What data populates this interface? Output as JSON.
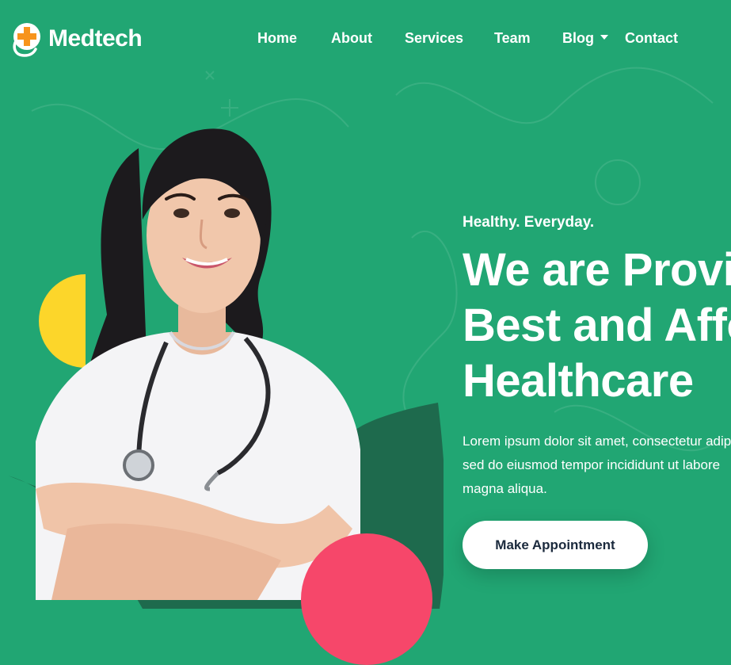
{
  "brand": {
    "name": "Medtech",
    "icon": "medical-cross-icon"
  },
  "nav": {
    "items": [
      {
        "label": "Home"
      },
      {
        "label": "About"
      },
      {
        "label": "Services"
      },
      {
        "label": "Team"
      },
      {
        "label": "Blog",
        "has_dropdown": true
      },
      {
        "label": "Contact"
      }
    ]
  },
  "hero": {
    "tagline": "Healthy. Everyday.",
    "headline_lines": [
      "We are Provi",
      "Best and Affo",
      "Healthcare"
    ],
    "description_lines": [
      "Lorem ipsum dolor sit amet, consectetur adip",
      "sed do eiusmod tempor incididunt ut labore",
      "magna aliqua."
    ],
    "cta_label": "Make Appointment",
    "image": "doctor-portrait"
  },
  "colors": {
    "background": "#21a673",
    "accent_dark": "#1e6a4d",
    "accent_yellow": "#fcd62a",
    "accent_pink": "#f6476a",
    "logo_orange": "#f7941d",
    "button_text": "#1b2a3d"
  }
}
